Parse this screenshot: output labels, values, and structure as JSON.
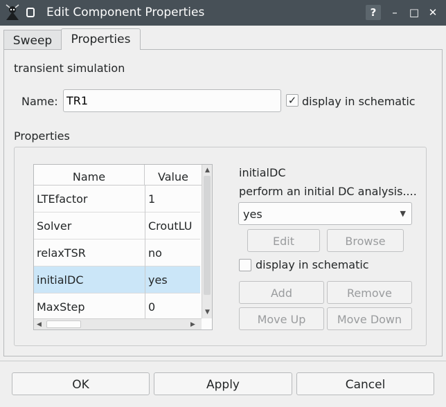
{
  "window": {
    "title": "Edit Component Properties",
    "help_glyph": "?",
    "minimize_glyph": "–",
    "maximize_glyph": "□",
    "close_glyph": "✕",
    "colors": {
      "titlebar": "#475057",
      "selection": "#cbe6f8"
    }
  },
  "tabs": [
    {
      "label": "Sweep",
      "active": false
    },
    {
      "label": "Properties",
      "active": true
    }
  ],
  "component": {
    "description": "transient simulation",
    "name_label": "Name:",
    "name_value": "TR1",
    "display_in_schematic_label": "display in schematic",
    "display_in_schematic_checked": true,
    "checkmark": "✓"
  },
  "properties": {
    "section_label": "Properties",
    "columns": [
      "Name",
      "Value"
    ],
    "rows": [
      {
        "name": "LTEfactor",
        "value": "1"
      },
      {
        "name": "Solver",
        "value": "CroutLU"
      },
      {
        "name": "relaxTSR",
        "value": "no"
      },
      {
        "name": "initialDC",
        "value": "yes",
        "selected": true
      },
      {
        "name": "MaxStep",
        "value": "0"
      }
    ]
  },
  "editor": {
    "param_name": "initialDC",
    "param_description": "perform an initial DC analysis....",
    "combo_value": "yes",
    "edit_label": "Edit",
    "browse_label": "Browse",
    "display_label": "display in schematic",
    "display_checked": false,
    "add_label": "Add",
    "remove_label": "Remove",
    "move_up_label": "Move Up",
    "move_down_label": "Move Down"
  },
  "dialog_buttons": {
    "ok": "OK",
    "apply": "Apply",
    "cancel": "Cancel"
  }
}
